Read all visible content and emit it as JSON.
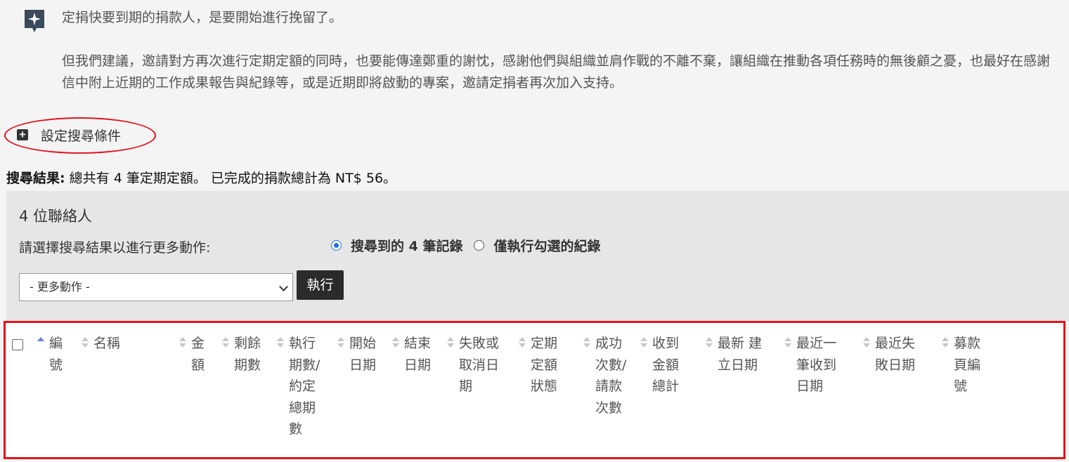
{
  "tip": {
    "icon": "sparkle-bookmark-icon",
    "line1": "定捐快要到期的捐款人，是要開始進行挽留了。",
    "line2": "但我們建議，邀請對方再次進行定期定額的同時，也要能傳達鄭重的謝忱，感謝他們與組織並肩作戰的不離不棄，讓組織在推動各項任務時的無後顧之憂，也最好在感謝信中附上近期的工作成果報告與紀錄等，或是近期即將啟動的專案，邀請定捐者再次加入支持。"
  },
  "search": {
    "toggle_label": "設定搜尋條件",
    "highlight_color": "#e0141e"
  },
  "summary": {
    "label": "搜尋結果:",
    "text": "總共有 4 筆定期定額。 已完成的捐款總計為 NT$ 56。"
  },
  "actions": {
    "title": "4 位聯絡人",
    "prompt": "請選擇搜尋結果以進行更多動作:",
    "radio_all": "搜尋到的 4 筆記錄",
    "radio_selected": "僅執行勾選的紀錄",
    "select_value": "- 更多動作 -",
    "execute_label": "執行"
  },
  "table": {
    "headers": [
      {
        "label": "編號",
        "sort": "asc"
      },
      {
        "label": "名稱",
        "sort": "none"
      },
      {
        "label": "金額",
        "sort": "none"
      },
      {
        "label": "剩餘期數",
        "sort": "none"
      },
      {
        "label": "執行期數/約定總期數",
        "sort": "none"
      },
      {
        "label": "開始日期",
        "sort": "none"
      },
      {
        "label": "結束日期",
        "sort": "none"
      },
      {
        "label": "失敗或取消日期",
        "sort": "none"
      },
      {
        "label": "定期定額狀態",
        "sort": "none"
      },
      {
        "label": "成功次數/請款次數",
        "sort": "none"
      },
      {
        "label": "收到金額總計",
        "sort": "none"
      },
      {
        "label": "最新 建立日期",
        "sort": "none"
      },
      {
        "label": "最近一筆收到日期",
        "sort": "none"
      },
      {
        "label": "最近失敗日期",
        "sort": "none"
      },
      {
        "label": "募款頁編號",
        "sort": "none"
      }
    ]
  }
}
